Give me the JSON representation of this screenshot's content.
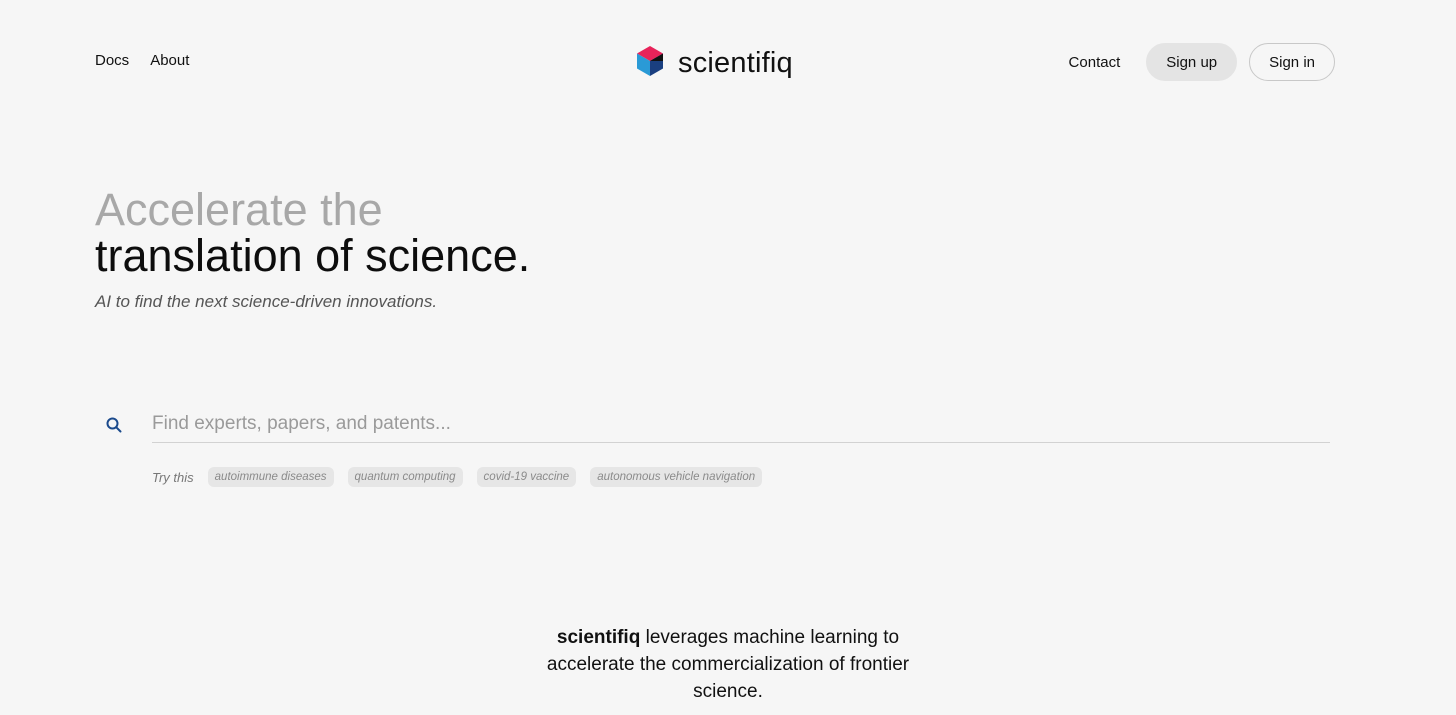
{
  "nav": {
    "left": [
      "Docs",
      "About"
    ],
    "contact": "Contact",
    "sign_up": "Sign up",
    "sign_in": "Sign in"
  },
  "brand": {
    "name": "scientifiq",
    "logo_icon": "hexagon-cube-icon",
    "colors": {
      "pink": "#e8235a",
      "blue": "#2a9ad6",
      "navy": "#1a3f80",
      "dark": "#111111"
    }
  },
  "hero": {
    "line1": "Accelerate the",
    "line2": "translation of science.",
    "subtitle": "AI to find the next science-driven innovations."
  },
  "search": {
    "placeholder": "Find experts, papers, and patents...",
    "icon": "search-icon",
    "icon_color": "#1b4a8c"
  },
  "suggestions": {
    "label": "Try this",
    "chips": [
      "autoimmune diseases",
      "quantum computing",
      "covid-19 vaccine",
      "autonomous vehicle navigation"
    ]
  },
  "tagline": {
    "brand": "scientifiq",
    "text": " leverages machine learning to accelerate the commercialization of frontier science."
  }
}
